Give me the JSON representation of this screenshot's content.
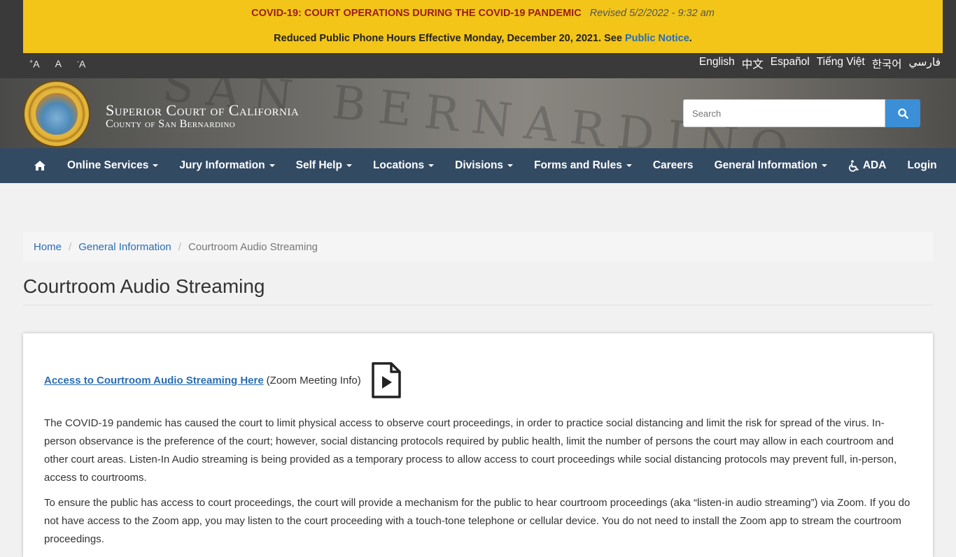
{
  "alert": {
    "title": "COVID-19: COURT OPERATIONS DURING THE COVID-19 PANDEMIC",
    "revised": "Revised 5/2/2022 - 9:32 am",
    "notice_prefix": "Reduced Public Phone Hours Effective Monday, December 20, 2021. See ",
    "notice_link": "Public Notice",
    "notice_suffix": "."
  },
  "font_sizer": {
    "increase": "A",
    "reset": "A",
    "decrease": "A",
    "increase_sign": "+",
    "decrease_sign": "-"
  },
  "languages": [
    "English",
    "中文",
    "Español",
    "Tiếng Việt",
    "한국어",
    "فارسي"
  ],
  "header": {
    "title": "Superior Court of California",
    "subtitle": "County of San Bernardino",
    "watermark": "SAN BERNARDINO"
  },
  "search": {
    "placeholder": "Search"
  },
  "nav": {
    "home_icon": "home-icon",
    "items": [
      {
        "label": "Online Services",
        "dropdown": true
      },
      {
        "label": "Jury Information",
        "dropdown": true
      },
      {
        "label": "Self Help",
        "dropdown": true
      },
      {
        "label": "Locations",
        "dropdown": true
      },
      {
        "label": "Divisions",
        "dropdown": true
      },
      {
        "label": "Forms and Rules",
        "dropdown": true
      },
      {
        "label": "Careers",
        "dropdown": false
      },
      {
        "label": "General Information",
        "dropdown": true
      },
      {
        "label": "ADA",
        "dropdown": false
      },
      {
        "label": "Login",
        "dropdown": false
      }
    ]
  },
  "breadcrumb": {
    "home": "Home",
    "section": "General Information",
    "current": "Courtroom Audio Streaming",
    "separator": "/"
  },
  "page": {
    "title": "Courtroom Audio Streaming",
    "access_link": "Access to Courtroom Audio Streaming Here",
    "access_note": "(Zoom Meeting Info)",
    "para1": "The COVID-19 pandemic has caused the court to limit physical access to observe court proceedings, in order to practice social distancing and limit the risk for spread of the virus. In-person observance is the preference of the court; however, social distancing protocols required by public health, limit the number of persons the court may allow in each courtroom and other court areas. Listen-In Audio streaming is being provided as a temporary process to allow access to court proceedings while social distancing protocols may prevent full, in-person, access to courtrooms.",
    "para2": "To ensure the public has access to court proceedings, the court will provide a mechanism for the public to hear courtroom proceedings (aka “listen-in audio streaming”) via Zoom. If you do not have access to the Zoom app, you may listen to the court proceeding with a touch-tone telephone or cellular device. You do not need to install the Zoom app to stream the courtroom proceedings."
  },
  "colors": {
    "alert_bg": "#f2c518",
    "alert_title": "#9b1c1c",
    "nav_bg": "#334a63",
    "link": "#2a6db3",
    "search_button": "#3a8fd6"
  }
}
